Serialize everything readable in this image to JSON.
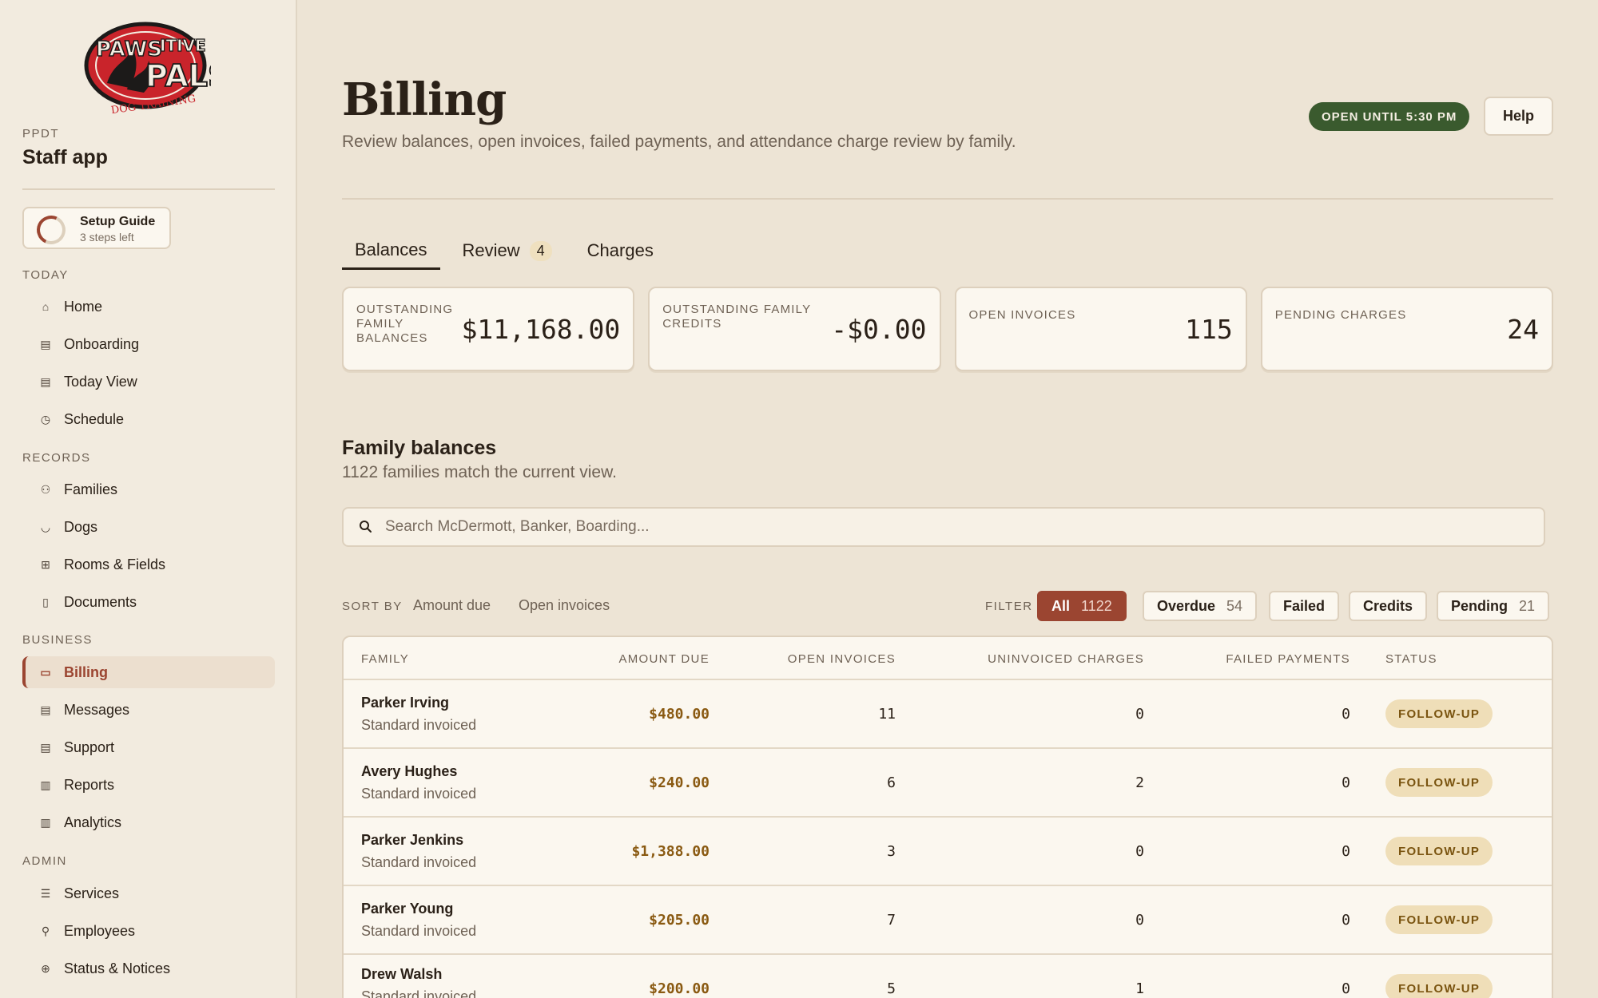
{
  "sidebar": {
    "org_code": "PPDT",
    "app_name": "Staff app",
    "logo": {
      "line1": "PAWS",
      "line2": "ITIVE",
      "line3": "PALS",
      "line4": "DOG TRAINING"
    },
    "setup": {
      "title": "Setup Guide",
      "subtitle": "3 steps left"
    },
    "sections": {
      "today": "TODAY",
      "records": "RECORDS",
      "business": "BUSINESS",
      "admin": "ADMIN"
    },
    "items": {
      "home": {
        "label": "Home",
        "icon": "home-icon"
      },
      "onboarding": {
        "label": "Onboarding",
        "icon": "form-icon"
      },
      "today_view": {
        "label": "Today View",
        "icon": "form-icon"
      },
      "schedule": {
        "label": "Schedule",
        "icon": "clock-icon"
      },
      "families": {
        "label": "Families",
        "icon": "people-icon"
      },
      "dogs": {
        "label": "Dogs",
        "icon": "dog-icon"
      },
      "rooms": {
        "label": "Rooms & Fields",
        "icon": "grid-icon"
      },
      "documents": {
        "label": "Documents",
        "icon": "document-icon"
      },
      "billing": {
        "label": "Billing",
        "icon": "card-icon"
      },
      "messages": {
        "label": "Messages",
        "icon": "message-icon"
      },
      "support": {
        "label": "Support",
        "icon": "message-icon"
      },
      "reports": {
        "label": "Reports",
        "icon": "chart-icon"
      },
      "analytics": {
        "label": "Analytics",
        "icon": "chart-icon"
      },
      "services": {
        "label": "Services",
        "icon": "list-icon"
      },
      "employees": {
        "label": "Employees",
        "icon": "user-list-icon"
      },
      "status": {
        "label": "Status & Notices",
        "icon": "globe-icon"
      }
    }
  },
  "header": {
    "title": "Billing",
    "subtitle": "Review balances, open invoices, failed payments, and attendance charge review by family.",
    "open_status": "OPEN UNTIL 5:30 PM",
    "help_label": "Help"
  },
  "tabs": {
    "balances": "Balances",
    "review": "Review",
    "review_count": "4",
    "charges": "Charges"
  },
  "cards": {
    "balances": {
      "label": "OUTSTANDING FAMILY BALANCES",
      "value": "$11,168.00"
    },
    "credits": {
      "label": "OUTSTANDING FAMILY CREDITS",
      "value": "-$0.00"
    },
    "invoices": {
      "label": "OPEN INVOICES",
      "value": "115"
    },
    "pending": {
      "label": "PENDING CHARGES",
      "value": "24"
    }
  },
  "section": {
    "title": "Family balances",
    "subtitle": "1122 families match the current view."
  },
  "search": {
    "placeholder": "Search McDermott, Banker, Boarding..."
  },
  "sort": {
    "label": "SORT BY",
    "amount_due": "Amount due",
    "open_invoices": "Open invoices"
  },
  "filter": {
    "label": "FILTER",
    "all": {
      "label": "All",
      "count": "1122"
    },
    "overdue": {
      "label": "Overdue",
      "count": "54"
    },
    "failed": {
      "label": "Failed"
    },
    "credits": {
      "label": "Credits"
    },
    "pending": {
      "label": "Pending",
      "count": "21"
    }
  },
  "table": {
    "headers": {
      "family": "FAMILY",
      "amount_due": "AMOUNT DUE",
      "open_invoices": "OPEN INVOICES",
      "uninvoiced": "UNINVOICED CHARGES",
      "failed": "FAILED PAYMENTS",
      "status": "STATUS"
    },
    "rows": [
      {
        "name": "Parker Irving",
        "plan": "Standard invoiced",
        "amount": "$480.00",
        "open": "11",
        "uninvoiced": "0",
        "failed": "0",
        "status": "FOLLOW-UP"
      },
      {
        "name": "Avery Hughes",
        "plan": "Standard invoiced",
        "amount": "$240.00",
        "open": "6",
        "uninvoiced": "2",
        "failed": "0",
        "status": "FOLLOW-UP"
      },
      {
        "name": "Parker Jenkins",
        "plan": "Standard invoiced",
        "amount": "$1,388.00",
        "open": "3",
        "uninvoiced": "0",
        "failed": "0",
        "status": "FOLLOW-UP"
      },
      {
        "name": "Parker Young",
        "plan": "Standard invoiced",
        "amount": "$205.00",
        "open": "7",
        "uninvoiced": "0",
        "failed": "0",
        "status": "FOLLOW-UP"
      },
      {
        "name": "Drew Walsh",
        "plan": "Standard invoiced",
        "amount": "$200.00",
        "open": "5",
        "uninvoiced": "1",
        "failed": "0",
        "status": "FOLLOW-UP"
      }
    ]
  },
  "colors": {
    "background": "#ede4d5",
    "accent": "#9b4531",
    "open_badge": "#3a5a2e",
    "status_badge": "#efdeb8",
    "amount": "#8a5a12"
  }
}
